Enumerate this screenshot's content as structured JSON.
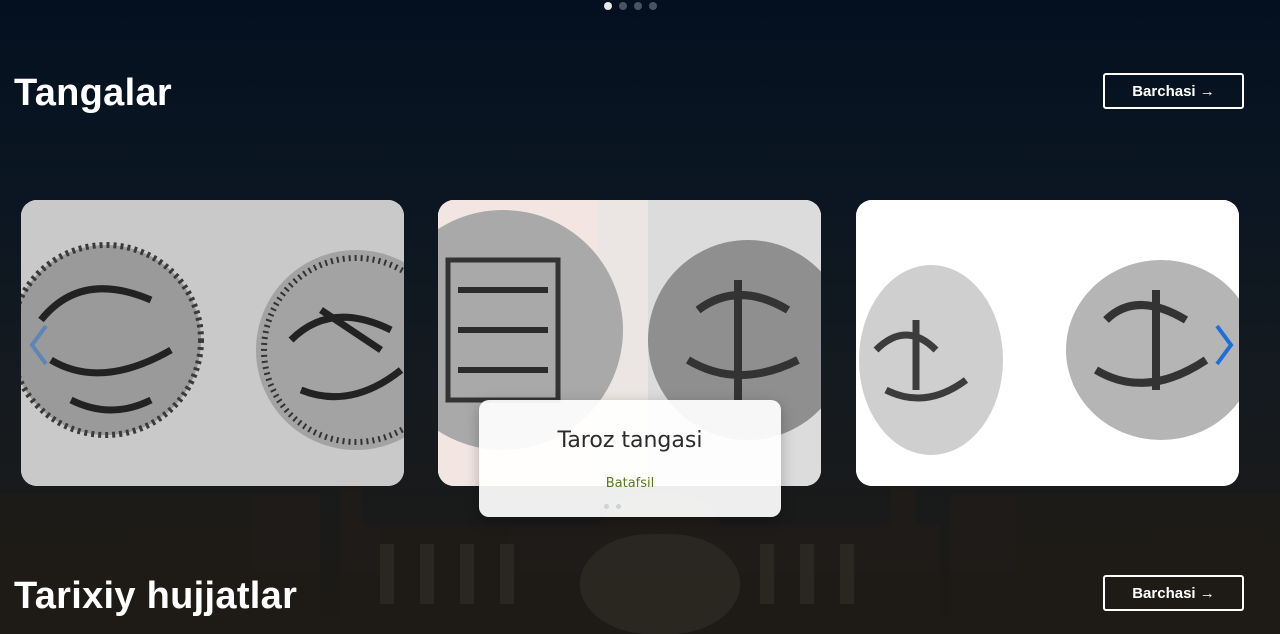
{
  "hero_carousel": {
    "active_index": 0,
    "count": 4
  },
  "sections": [
    {
      "title": "Tangalar",
      "all_button": "Barchasi →"
    },
    {
      "title": "Tarixiy hujjatlar",
      "all_button": "Barchasi →"
    }
  ],
  "coins_carousel": {
    "cards": [
      {
        "image_icon": "coin-photo-icon"
      },
      {
        "image_icon": "coin-photo-icon"
      },
      {
        "image_icon": "coin-photo-icon"
      }
    ],
    "popup": {
      "title": "Taroz tangasi",
      "link": "Batafsil"
    },
    "prev_icon": "chevron-left-icon",
    "next_icon": "chevron-right-icon",
    "arrow_color": "#1e6fd9"
  }
}
